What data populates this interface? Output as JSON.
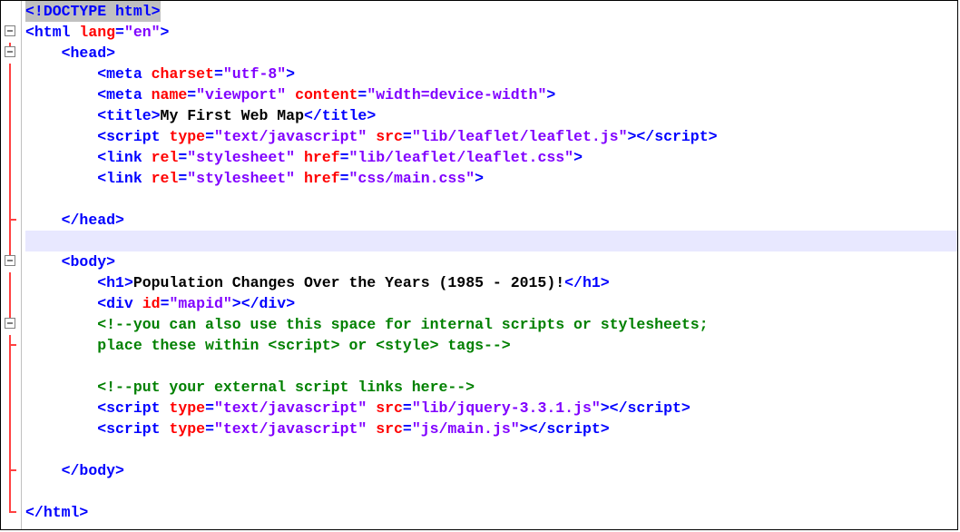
{
  "lines": [
    {
      "g": "none",
      "cursor": false,
      "sel": true,
      "indent": 0,
      "seg": [
        {
          "t": "<!",
          "c": "kw"
        },
        {
          "t": "DOCTYPE",
          "c": "kw"
        },
        {
          "t": " ",
          "c": "kw"
        },
        {
          "t": "html",
          "c": "kw"
        },
        {
          "t": ">",
          "c": "kw"
        }
      ]
    },
    {
      "g": "fold",
      "indent": 0,
      "seg": [
        {
          "t": "<",
          "c": "kw"
        },
        {
          "t": "html",
          "c": "kw"
        },
        {
          "t": " ",
          "c": "txt"
        },
        {
          "t": "lang",
          "c": "attr"
        },
        {
          "t": "=",
          "c": "kw"
        },
        {
          "t": "\"en\"",
          "c": "str"
        },
        {
          "t": ">",
          "c": "kw"
        }
      ]
    },
    {
      "g": "fold",
      "indent": 1,
      "seg": [
        {
          "t": "<",
          "c": "kw"
        },
        {
          "t": "head",
          "c": "kw"
        },
        {
          "t": ">",
          "c": "kw"
        }
      ]
    },
    {
      "g": "tree",
      "indent": 2,
      "seg": [
        {
          "t": "<",
          "c": "kw"
        },
        {
          "t": "meta",
          "c": "kw"
        },
        {
          "t": " ",
          "c": "txt"
        },
        {
          "t": "charset",
          "c": "attr"
        },
        {
          "t": "=",
          "c": "kw"
        },
        {
          "t": "\"utf-8\"",
          "c": "str"
        },
        {
          "t": ">",
          "c": "kw"
        }
      ]
    },
    {
      "g": "tree",
      "indent": 2,
      "seg": [
        {
          "t": "<",
          "c": "kw"
        },
        {
          "t": "meta",
          "c": "kw"
        },
        {
          "t": " ",
          "c": "txt"
        },
        {
          "t": "name",
          "c": "attr"
        },
        {
          "t": "=",
          "c": "kw"
        },
        {
          "t": "\"viewport\"",
          "c": "str"
        },
        {
          "t": " ",
          "c": "txt"
        },
        {
          "t": "content",
          "c": "attr"
        },
        {
          "t": "=",
          "c": "kw"
        },
        {
          "t": "\"width=device-width\"",
          "c": "str"
        },
        {
          "t": ">",
          "c": "kw"
        }
      ]
    },
    {
      "g": "tree",
      "indent": 2,
      "seg": [
        {
          "t": "<",
          "c": "kw"
        },
        {
          "t": "title",
          "c": "kw"
        },
        {
          "t": ">",
          "c": "kw"
        },
        {
          "t": "My First Web Map",
          "c": "txt"
        },
        {
          "t": "</",
          "c": "kw"
        },
        {
          "t": "title",
          "c": "kw"
        },
        {
          "t": ">",
          "c": "kw"
        }
      ]
    },
    {
      "g": "tree",
      "indent": 2,
      "seg": [
        {
          "t": "<",
          "c": "kw"
        },
        {
          "t": "script",
          "c": "kw"
        },
        {
          "t": " ",
          "c": "txt"
        },
        {
          "t": "type",
          "c": "attr"
        },
        {
          "t": "=",
          "c": "kw"
        },
        {
          "t": "\"text/javascript\"",
          "c": "str"
        },
        {
          "t": " ",
          "c": "txt"
        },
        {
          "t": "src",
          "c": "attr"
        },
        {
          "t": "=",
          "c": "kw"
        },
        {
          "t": "\"lib/leaflet/leaflet.js\"",
          "c": "str"
        },
        {
          "t": ">",
          "c": "kw"
        },
        {
          "t": "</",
          "c": "kw"
        },
        {
          "t": "script",
          "c": "kw"
        },
        {
          "t": ">",
          "c": "kw"
        }
      ]
    },
    {
      "g": "tree",
      "indent": 2,
      "seg": [
        {
          "t": "<",
          "c": "kw"
        },
        {
          "t": "link",
          "c": "kw"
        },
        {
          "t": " ",
          "c": "txt"
        },
        {
          "t": "rel",
          "c": "attr"
        },
        {
          "t": "=",
          "c": "kw"
        },
        {
          "t": "\"stylesheet\"",
          "c": "str"
        },
        {
          "t": " ",
          "c": "txt"
        },
        {
          "t": "href",
          "c": "attr"
        },
        {
          "t": "=",
          "c": "kw"
        },
        {
          "t": "\"lib/leaflet/leaflet.css\"",
          "c": "str"
        },
        {
          "t": ">",
          "c": "kw"
        }
      ]
    },
    {
      "g": "tree",
      "indent": 2,
      "seg": [
        {
          "t": "<",
          "c": "kw"
        },
        {
          "t": "link",
          "c": "kw"
        },
        {
          "t": " ",
          "c": "txt"
        },
        {
          "t": "rel",
          "c": "attr"
        },
        {
          "t": "=",
          "c": "kw"
        },
        {
          "t": "\"stylesheet\"",
          "c": "str"
        },
        {
          "t": " ",
          "c": "txt"
        },
        {
          "t": "href",
          "c": "attr"
        },
        {
          "t": "=",
          "c": "kw"
        },
        {
          "t": "\"css/main.css\"",
          "c": "str"
        },
        {
          "t": ">",
          "c": "kw"
        }
      ]
    },
    {
      "g": "tree",
      "indent": 2,
      "seg": []
    },
    {
      "g": "tree-end",
      "indent": 1,
      "seg": [
        {
          "t": "</",
          "c": "kw"
        },
        {
          "t": "head",
          "c": "kw"
        },
        {
          "t": ">",
          "c": "kw"
        }
      ]
    },
    {
      "g": "tree",
      "cursor": true,
      "indent": 0,
      "seg": []
    },
    {
      "g": "fold",
      "indent": 1,
      "seg": [
        {
          "t": "<",
          "c": "kw"
        },
        {
          "t": "body",
          "c": "kw"
        },
        {
          "t": ">",
          "c": "kw"
        }
      ]
    },
    {
      "g": "tree",
      "indent": 2,
      "seg": [
        {
          "t": "<",
          "c": "kw"
        },
        {
          "t": "h1",
          "c": "kw"
        },
        {
          "t": ">",
          "c": "kw"
        },
        {
          "t": "Population Changes Over the Years (1985 - 2015)!",
          "c": "txt"
        },
        {
          "t": "</",
          "c": "kw"
        },
        {
          "t": "h1",
          "c": "kw"
        },
        {
          "t": ">",
          "c": "kw"
        }
      ]
    },
    {
      "g": "tree",
      "indent": 2,
      "seg": [
        {
          "t": "<",
          "c": "kw"
        },
        {
          "t": "div",
          "c": "kw"
        },
        {
          "t": " ",
          "c": "txt"
        },
        {
          "t": "id",
          "c": "attr"
        },
        {
          "t": "=",
          "c": "kw"
        },
        {
          "t": "\"mapid\"",
          "c": "str"
        },
        {
          "t": ">",
          "c": "kw"
        },
        {
          "t": "</",
          "c": "kw"
        },
        {
          "t": "div",
          "c": "kw"
        },
        {
          "t": ">",
          "c": "kw"
        }
      ]
    },
    {
      "g": "fold",
      "indent": 2,
      "seg": [
        {
          "t": "<!--you can also use this space for internal scripts or stylesheets;",
          "c": "cm"
        }
      ]
    },
    {
      "g": "tree-end",
      "indent": 2,
      "seg": [
        {
          "t": "place these within <script> or <style> tags-->",
          "c": "cm"
        }
      ]
    },
    {
      "g": "tree",
      "indent": 2,
      "seg": []
    },
    {
      "g": "tree",
      "indent": 2,
      "seg": [
        {
          "t": "<!--put your external script links here-->",
          "c": "cm"
        }
      ]
    },
    {
      "g": "tree",
      "indent": 2,
      "seg": [
        {
          "t": "<",
          "c": "kw"
        },
        {
          "t": "script",
          "c": "kw"
        },
        {
          "t": " ",
          "c": "txt"
        },
        {
          "t": "type",
          "c": "attr"
        },
        {
          "t": "=",
          "c": "kw"
        },
        {
          "t": "\"text/javascript\"",
          "c": "str"
        },
        {
          "t": " ",
          "c": "txt"
        },
        {
          "t": "src",
          "c": "attr"
        },
        {
          "t": "=",
          "c": "kw"
        },
        {
          "t": "\"lib/jquery-3.3.1.js\"",
          "c": "str"
        },
        {
          "t": ">",
          "c": "kw"
        },
        {
          "t": "</",
          "c": "kw"
        },
        {
          "t": "script",
          "c": "kw"
        },
        {
          "t": ">",
          "c": "kw"
        }
      ]
    },
    {
      "g": "tree",
      "indent": 2,
      "seg": [
        {
          "t": "<",
          "c": "kw"
        },
        {
          "t": "script",
          "c": "kw"
        },
        {
          "t": " ",
          "c": "txt"
        },
        {
          "t": "type",
          "c": "attr"
        },
        {
          "t": "=",
          "c": "kw"
        },
        {
          "t": "\"text/javascript\"",
          "c": "str"
        },
        {
          "t": " ",
          "c": "txt"
        },
        {
          "t": "src",
          "c": "attr"
        },
        {
          "t": "=",
          "c": "kw"
        },
        {
          "t": "\"js/main.js\"",
          "c": "str"
        },
        {
          "t": ">",
          "c": "kw"
        },
        {
          "t": "</",
          "c": "kw"
        },
        {
          "t": "script",
          "c": "kw"
        },
        {
          "t": ">",
          "c": "kw"
        }
      ]
    },
    {
      "g": "tree",
      "indent": 2,
      "seg": []
    },
    {
      "g": "tree-end",
      "indent": 1,
      "seg": [
        {
          "t": "</",
          "c": "kw"
        },
        {
          "t": "body",
          "c": "kw"
        },
        {
          "t": ">",
          "c": "kw"
        }
      ]
    },
    {
      "g": "tree",
      "indent": 0,
      "seg": []
    },
    {
      "g": "tree-end",
      "indent": 0,
      "seg": [
        {
          "t": "</",
          "c": "kw"
        },
        {
          "t": "html",
          "c": "kw"
        },
        {
          "t": ">",
          "c": "kw"
        }
      ]
    }
  ]
}
